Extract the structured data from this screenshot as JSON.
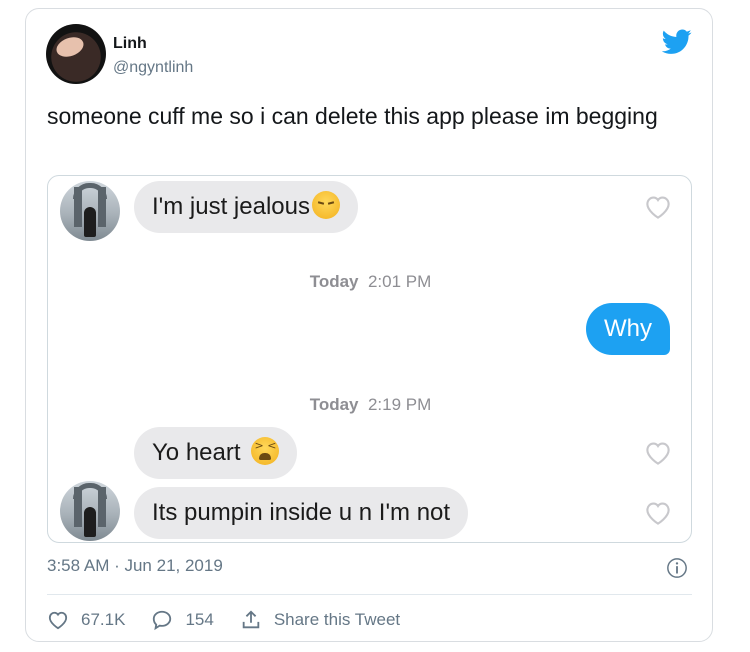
{
  "author": {
    "name": "Linh",
    "handle": "@ngyntlinh"
  },
  "tweet": {
    "text": "someone cuff me so i can delete this app please im begging",
    "timestamp": "3:58 AM · Jun 21, 2019"
  },
  "screenshot": {
    "messages": [
      {
        "side": "left",
        "text": "I'm just jealous",
        "emoji": "pensive-face-emoji"
      },
      {
        "side": "right",
        "text": "Why"
      },
      {
        "side": "left",
        "text": "Yo heart",
        "emoji": "weary-face-emoji"
      },
      {
        "side": "left",
        "text": "Its pumpin inside u n I'm not"
      }
    ],
    "time1": {
      "day": "Today",
      "time": "2:01 PM"
    },
    "time2": {
      "day": "Today",
      "time": "2:19 PM"
    }
  },
  "actions": {
    "likes": "67.1K",
    "replies": "154",
    "share_label": "Share this Tweet"
  },
  "colors": {
    "accent": "#1da1f2",
    "muted_text": "#657786",
    "bubble_gray": "#e9e9eb"
  }
}
